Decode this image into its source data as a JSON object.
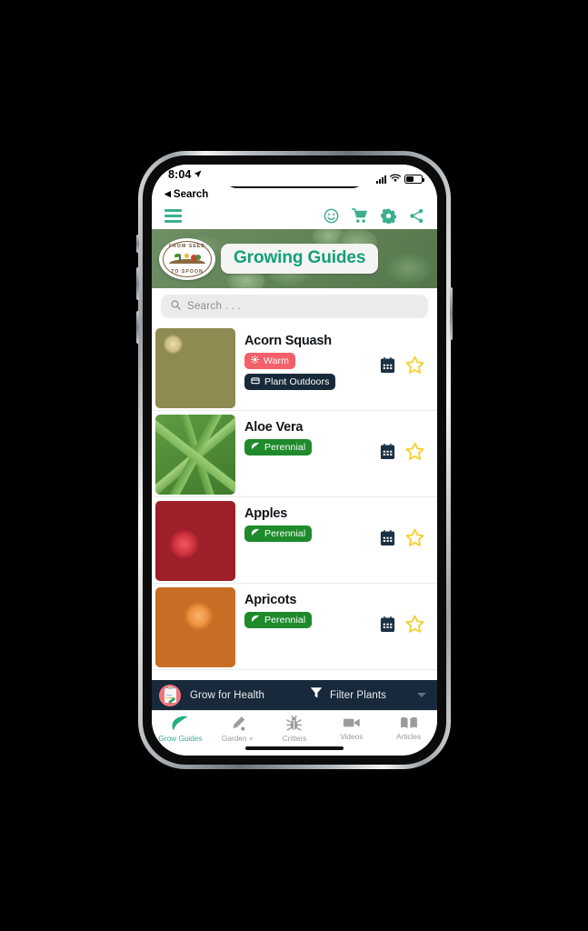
{
  "status_bar": {
    "time": "8:04",
    "location_icon": "location-arrow-icon",
    "signal_icon": "cellular-bars-icon",
    "wifi_icon": "wifi-icon",
    "battery_icon": "battery-icon"
  },
  "back_link": {
    "label": "Search",
    "icon": "back-triangle-icon"
  },
  "toolbar": {
    "menu_icon": "hamburger-menu-icon",
    "icons": [
      {
        "name": "smiley-face-icon",
        "label": "Smiley"
      },
      {
        "name": "shopping-cart-icon",
        "label": "Cart"
      },
      {
        "name": "gear-icon",
        "label": "Settings"
      },
      {
        "name": "share-icon",
        "label": "Share"
      }
    ],
    "accent_color": "#3bb08f"
  },
  "banner": {
    "title": "Growing Guides",
    "title_color": "#13a07a",
    "logo": {
      "arc_top": "FROM SEED",
      "arc_bottom": "TO SPOON"
    }
  },
  "search": {
    "placeholder": "Search . . .",
    "icon": "search-icon"
  },
  "plants": [
    {
      "name": "Acorn Squash",
      "thumb_class": "squash",
      "badges": [
        {
          "label": "Warm",
          "type": "warm",
          "icon": "sun-icon",
          "color": "#f4606a"
        },
        {
          "label": "Plant Outdoors",
          "type": "outdoors",
          "icon": "seed-tray-icon",
          "color": "#18293a"
        }
      ],
      "calendar_icon": "calendar-icon",
      "star_icon": "star-outline-icon"
    },
    {
      "name": "Aloe Vera",
      "thumb_class": "aloe",
      "badges": [
        {
          "label": "Perennial",
          "type": "perennial",
          "icon": "leaf-icon",
          "color": "#1f8a2c"
        }
      ],
      "calendar_icon": "calendar-icon",
      "star_icon": "star-outline-icon"
    },
    {
      "name": "Apples",
      "thumb_class": "apples",
      "badges": [
        {
          "label": "Perennial",
          "type": "perennial",
          "icon": "leaf-icon",
          "color": "#1f8a2c"
        }
      ],
      "calendar_icon": "calendar-icon",
      "star_icon": "star-outline-icon"
    },
    {
      "name": "Apricots",
      "thumb_class": "apricots",
      "badges": [
        {
          "label": "Perennial",
          "type": "perennial",
          "icon": "leaf-icon",
          "color": "#1f8a2c"
        }
      ],
      "calendar_icon": "calendar-icon",
      "star_icon": "star-outline-icon"
    }
  ],
  "filter_bar": {
    "health_label": "Grow for Health",
    "health_icon": "clipboard-checklist-icon",
    "filter_label": "Filter Plants",
    "filter_icon": "funnel-icon",
    "caret_icon": "chevron-down-icon",
    "background": "#17293a"
  },
  "tab_bar": {
    "active_color": "#3bb08f",
    "inactive_color": "#9b9b9f",
    "tabs": [
      {
        "label": "Grow Guides",
        "icon": "leaf-icon",
        "active": true
      },
      {
        "label": "Garden +",
        "icon": "trowel-icon",
        "active": false
      },
      {
        "label": "Critters",
        "icon": "bug-icon",
        "active": false
      },
      {
        "label": "Videos",
        "icon": "video-camera-icon",
        "active": false
      },
      {
        "label": "Articles",
        "icon": "open-book-icon",
        "active": false
      }
    ]
  }
}
